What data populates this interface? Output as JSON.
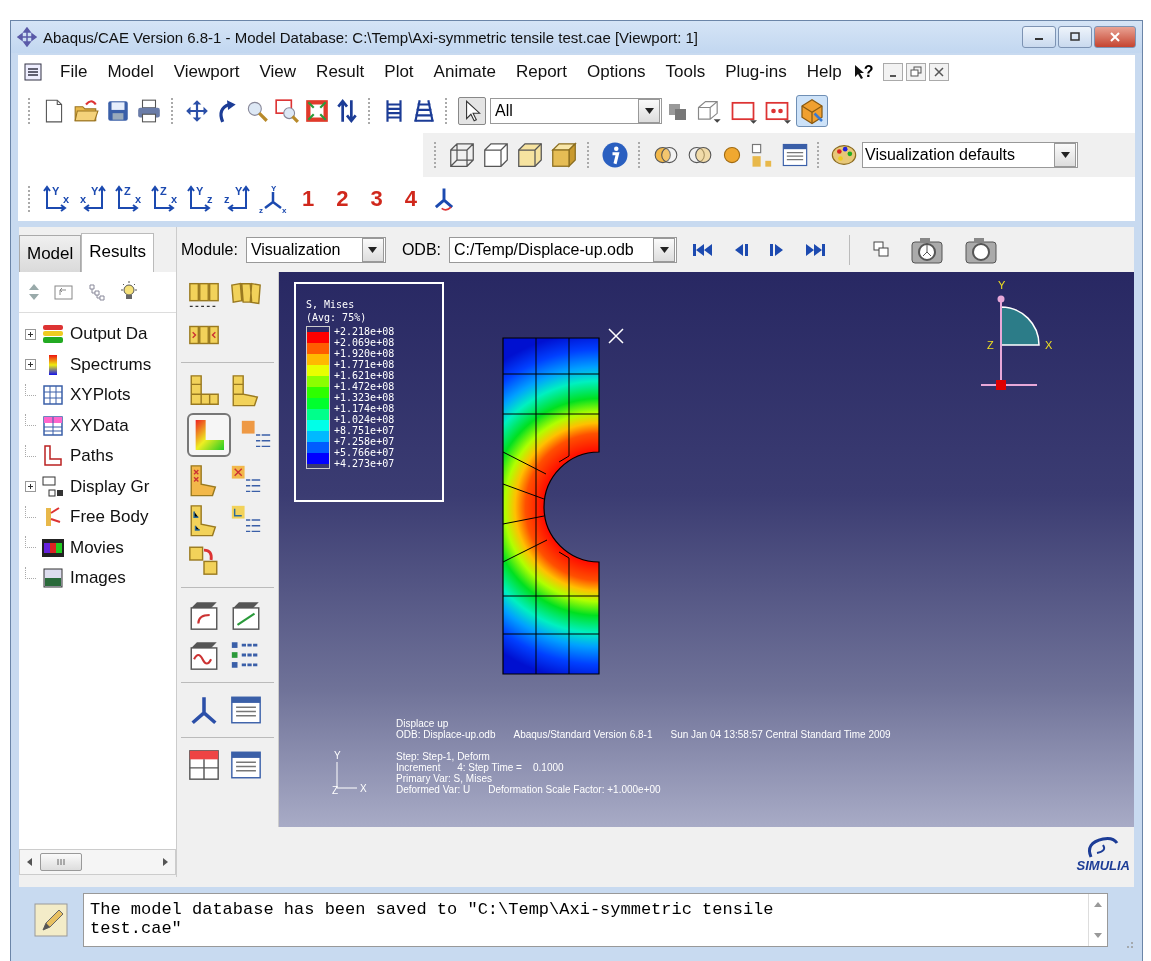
{
  "window": {
    "title": "Abaqus/CAE Version 6.8-1 - Model Database: C:\\Temp\\Axi-symmetric tensile test.cae [Viewport: 1]"
  },
  "menu": [
    "File",
    "Model",
    "Viewport",
    "View",
    "Result",
    "Plot",
    "Animate",
    "Report",
    "Options",
    "Tools",
    "Plug-ins",
    "Help"
  ],
  "context_help": "?",
  "selection_filter": {
    "value": "All"
  },
  "render_style": {
    "value": "Visualization defaults"
  },
  "axis_views": [
    {
      "v": "Y",
      "h": "x"
    },
    {
      "v": "Y",
      "h": "x"
    },
    {
      "v": "Z",
      "h": "x"
    },
    {
      "v": "Z",
      "h": "x"
    },
    {
      "v": "Y",
      "h": "z"
    },
    {
      "v": "Y",
      "h": "z"
    }
  ],
  "iso_view": {
    "top": "Y",
    "left": "z",
    "right": "x"
  },
  "viewport_numbers": [
    "1",
    "2",
    "3",
    "4"
  ],
  "tabs": [
    {
      "label": "Model",
      "selected": false
    },
    {
      "label": "Results",
      "selected": true
    }
  ],
  "module": {
    "label": "Module:",
    "value": "Visualization"
  },
  "odb": {
    "label": "ODB:",
    "value": "C:/Temp/Displace-up.odb"
  },
  "tree": [
    {
      "label": "Output Da",
      "expandable": true
    },
    {
      "label": "Spectrums",
      "expandable": true
    },
    {
      "label": "XYPlots",
      "expandable": false
    },
    {
      "label": "XYData",
      "expandable": false
    },
    {
      "label": "Paths",
      "expandable": false
    },
    {
      "label": "Display Gr",
      "expandable": true
    },
    {
      "label": "Free Body",
      "expandable": false
    },
    {
      "label": "Movies",
      "expandable": false
    },
    {
      "label": "Images",
      "expandable": false
    }
  ],
  "legend": {
    "title": "S, Mises",
    "subtitle": "(Avg: 75%)",
    "labels": [
      "+2.218e+08",
      "+2.069e+08",
      "+1.920e+08",
      "+1.771e+08",
      "+1.621e+08",
      "+1.472e+08",
      "+1.323e+08",
      "+1.174e+08",
      "+1.024e+08",
      "+8.751e+07",
      "+7.258e+07",
      "+5.766e+07",
      "+4.273e+07"
    ],
    "bands": [
      {
        "color": "#ff0000"
      },
      {
        "color": "#ff5d00"
      },
      {
        "color": "#ffb900"
      },
      {
        "color": "#e8ff00"
      },
      {
        "color": "#8bff00"
      },
      {
        "color": "#2eff00"
      },
      {
        "color": "#00ff2e"
      },
      {
        "color": "#00ff8b"
      },
      {
        "color": "#00ffe8"
      },
      {
        "color": "#00b9ff"
      },
      {
        "color": "#005dff"
      },
      {
        "color": "#0000ff"
      }
    ]
  },
  "triad": {
    "y": "Y",
    "z": "Z",
    "x": "X"
  },
  "info": {
    "title": "Displace up",
    "odb": "ODB: Displace-up.odb",
    "version": "Abaqus/Standard Version 6.8-1",
    "date": "Sun Jan 04 13:58:57 Central Standard Time 2009",
    "step": "Step: Step-1, Deform",
    "increment": "Increment      4: Step Time =    0.1000",
    "primary": "Primary Var: S, Mises",
    "deformed": "Deformed Var: U",
    "scale": "Deformation Scale Factor: +1.000e+00"
  },
  "small_triad": {
    "y": "Y",
    "z": "Z",
    "x": "X"
  },
  "logo": {
    "text": "SIMULIA"
  },
  "messages": [
    "The model database has been saved to \"C:\\Temp\\Axi-symmetric tensile",
    "test.cae\""
  ]
}
